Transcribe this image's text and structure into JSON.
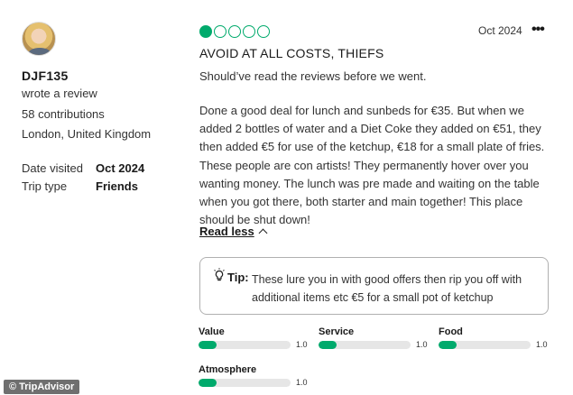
{
  "reviewer": {
    "name": "DJF135",
    "action": "wrote a review",
    "contributions": "58 contributions",
    "location": "London, United Kingdom",
    "date_visited_label": "Date visited",
    "date_visited": "Oct 2024",
    "trip_type_label": "Trip type",
    "trip_type": "Friends"
  },
  "review": {
    "rating": 1,
    "rating_max": 5,
    "date": "Oct 2024",
    "more_icon": "more-horizontal-icon",
    "title": "AVOID AT ALL COSTS, THIEFS",
    "paragraph1": "Should’ve read the reviews before we went.",
    "paragraph2": "Done a good deal for lunch and sunbeds for €35. But when we added 2 bottles of water and a Diet Coke they added on €51, they then added €5 for use of the ketchup, €18 for a small plate of fries. These people are con artists! They permanently hover over you wanting money. The lunch was pre made and waiting on the table when you got there, both starter and main together! This place should be shut down!",
    "read_less": "Read less",
    "tip_label": "Tip:",
    "tip_text": "These lure you in with good offers then rip you off with additional items etc €5 for a small pot of ketchup"
  },
  "subratings": [
    {
      "label": "Value",
      "value": "1.0",
      "score": 1.0,
      "max": 5
    },
    {
      "label": "Service",
      "value": "1.0",
      "score": 1.0,
      "max": 5
    },
    {
      "label": "Food",
      "value": "1.0",
      "score": 1.0,
      "max": 5
    },
    {
      "label": "Atmosphere",
      "value": "1.0",
      "score": 1.0,
      "max": 5
    }
  ],
  "watermark": "© TripAdvisor",
  "colors": {
    "accent": "#00aa6c",
    "track": "#e6e6e6"
  }
}
